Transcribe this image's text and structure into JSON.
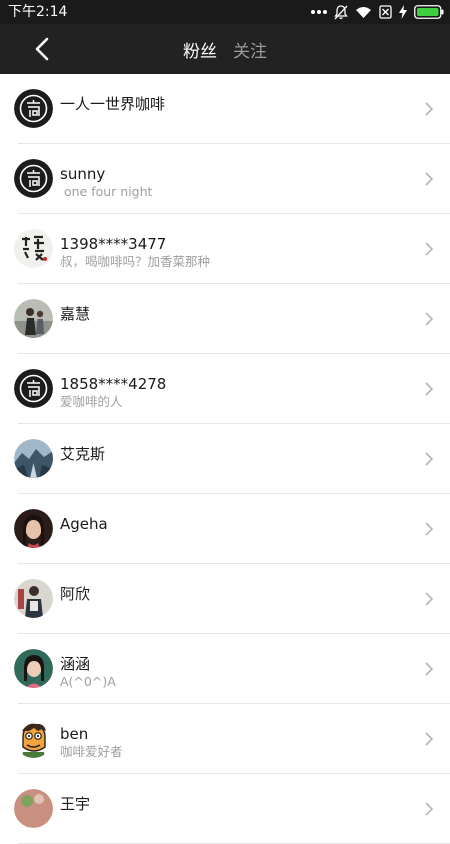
{
  "status_bar": {
    "time": "下午2:14"
  },
  "nav": {
    "tabs": [
      {
        "label": "粉丝",
        "active": true
      },
      {
        "label": "关注",
        "active": false
      }
    ]
  },
  "users": [
    {
      "name": "一人一世界咖啡",
      "bio": "",
      "avatar": "cafe-logo-avatar"
    },
    {
      "name": "sunny",
      "bio": " one four night",
      "avatar": "cafe-logo-avatar"
    },
    {
      "name": "1398****3477",
      "bio": "叔，喝咖啡吗？加香菜那种",
      "avatar": "calligraphy-avatar"
    },
    {
      "name": "嘉慧",
      "bio": "",
      "avatar": "photo-avatar"
    },
    {
      "name": "1858****4278",
      "bio": "爱咖啡的人",
      "avatar": "cafe-logo-avatar"
    },
    {
      "name": "艾克斯",
      "bio": "",
      "avatar": "landscape-avatar"
    },
    {
      "name": "Ageha",
      "bio": "",
      "avatar": "portrait-avatar"
    },
    {
      "name": "阿欣",
      "bio": "",
      "avatar": "photo-avatar"
    },
    {
      "name": "涵涵",
      "bio": "A(^0^)A",
      "avatar": "portrait-avatar"
    },
    {
      "name": "ben",
      "bio": "咖啡爱好者",
      "avatar": "cartoon-avatar"
    },
    {
      "name": "王宇",
      "bio": "",
      "avatar": "photo-avatar"
    }
  ],
  "colors": {
    "navbar": "#222222",
    "statusbar": "#1a1a1a",
    "active_tab": "#ffffff",
    "inactive_tab": "#9a9a9a",
    "subtext": "#a0a0a0"
  }
}
